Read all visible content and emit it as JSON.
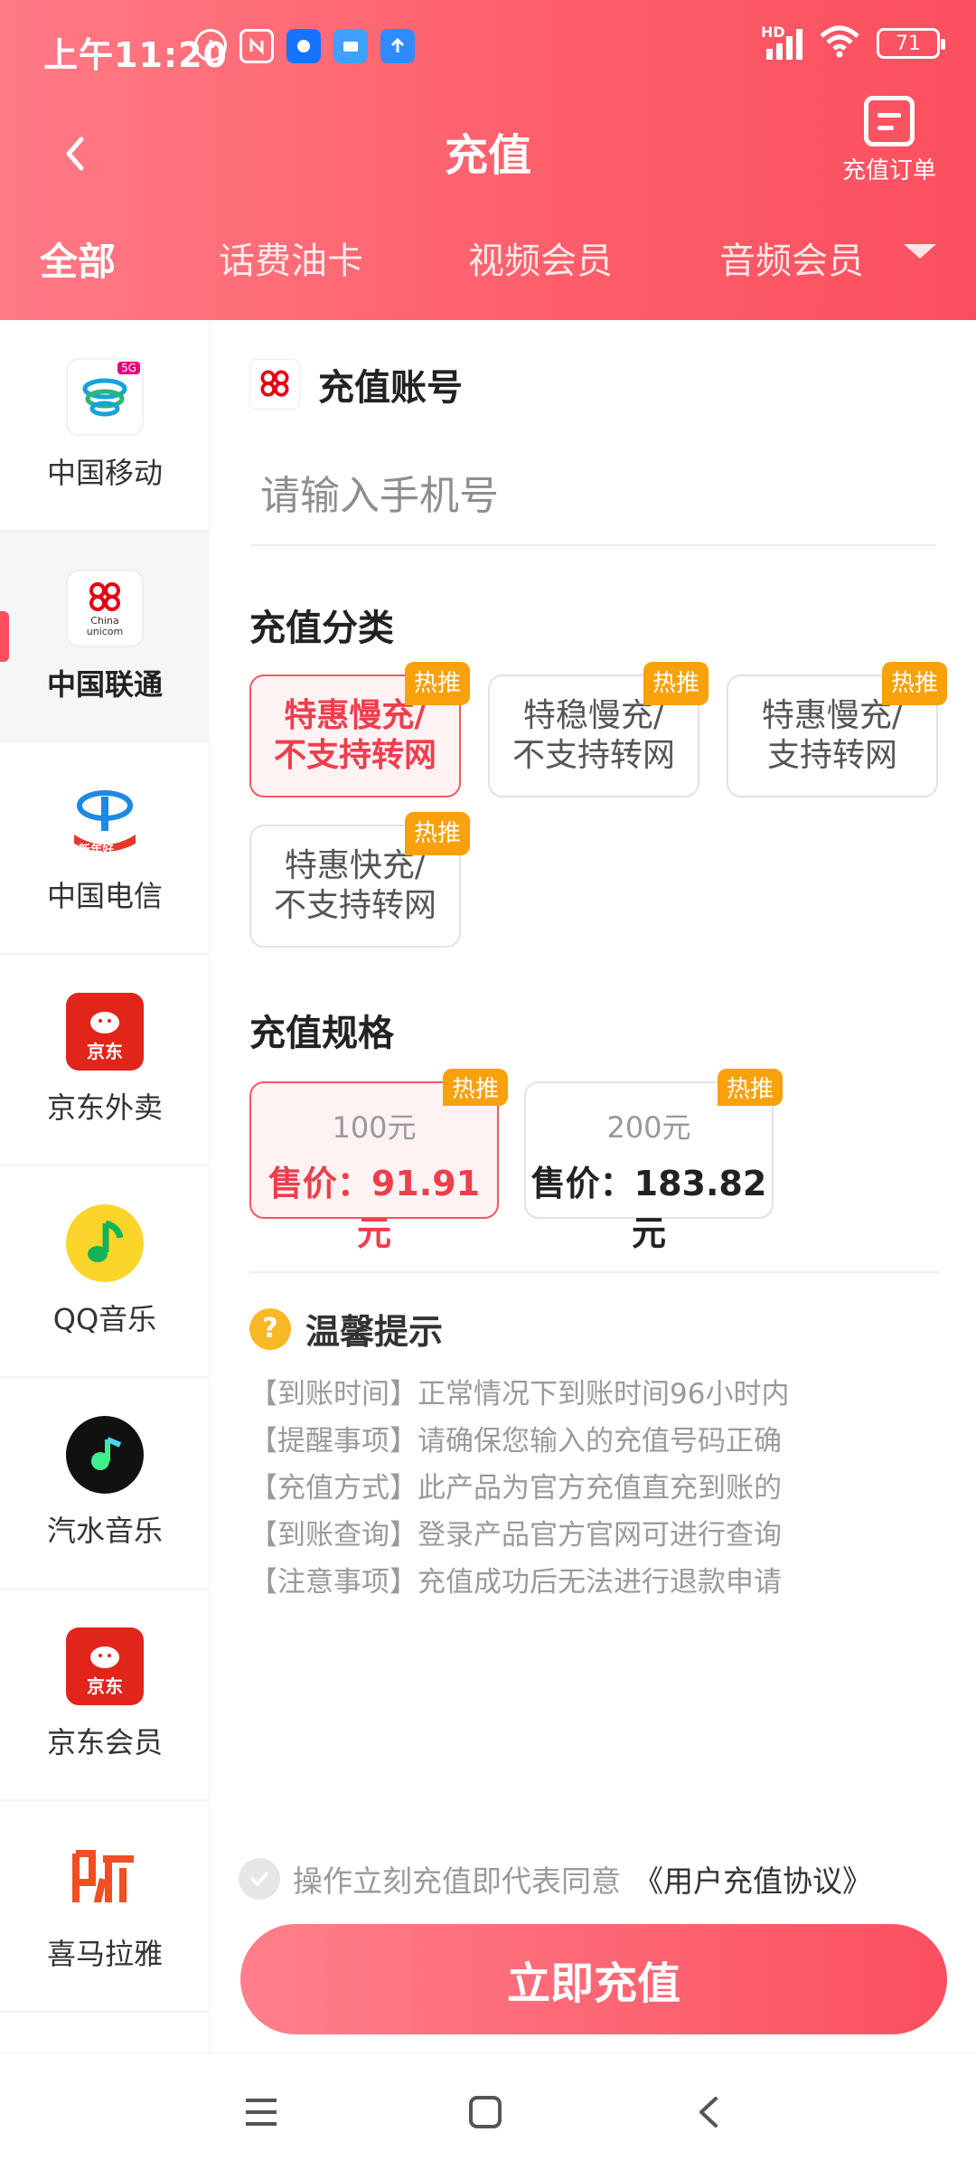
{
  "status_bar": {
    "time": "上午11:20",
    "hd_label": "HD",
    "battery": "71"
  },
  "header": {
    "title": "充值",
    "order_label": "充值订单"
  },
  "tabs": [
    {
      "label": "全部",
      "active": true
    },
    {
      "label": "话费油卡",
      "active": false
    },
    {
      "label": "视频会员",
      "active": false
    },
    {
      "label": "音频会员",
      "active": false
    }
  ],
  "sidebar": {
    "items": [
      {
        "label": "中国移动",
        "icon": "china-mobile-icon"
      },
      {
        "label": "中国联通",
        "icon": "china-unicom-icon",
        "active": true
      },
      {
        "label": "中国电信",
        "icon": "china-telecom-icon"
      },
      {
        "label": "京东外卖",
        "icon": "jd-icon"
      },
      {
        "label": "QQ音乐",
        "icon": "qq-music-icon"
      },
      {
        "label": "汽水音乐",
        "icon": "qishui-music-icon"
      },
      {
        "label": "京东会员",
        "icon": "jd-icon"
      },
      {
        "label": "喜马拉雅",
        "icon": "ximalaya-icon"
      }
    ],
    "unicom_logo_text": "China unicom",
    "mobile_badge": "5G",
    "telecom_badge": "新年好",
    "jd_logo_text": "京东"
  },
  "account": {
    "title": "充值账号",
    "placeholder": "请输入手机号",
    "logo_text": "China unicom"
  },
  "category": {
    "title": "充值分类",
    "items": [
      {
        "line1": "特惠慢充/",
        "line2": "不支持转网",
        "badge": "热推",
        "selected": true
      },
      {
        "line1": "特稳慢充/",
        "line2": "不支持转网",
        "badge": "热推",
        "selected": false
      },
      {
        "line1": "特惠慢充/",
        "line2": "支持转网",
        "badge": "热推",
        "selected": false
      },
      {
        "line1": "特惠快充/",
        "line2": "不支持转网",
        "badge": "热推",
        "selected": false
      }
    ]
  },
  "spec": {
    "title": "充值规格",
    "items": [
      {
        "face": "100元",
        "price": "售价：91.91元",
        "badge": "热推",
        "selected": true
      },
      {
        "face": "200元",
        "price": "售价：183.82元",
        "badge": "热推",
        "selected": false
      }
    ]
  },
  "tips": {
    "title": "温馨提示",
    "items": [
      "【到账时间】正常情况下到账时间96小时内",
      "【提醒事项】请确保您输入的充值号码正确",
      "【充值方式】此产品为官方充值直充到账的",
      "【到账查询】登录产品官方官网可进行查询",
      "【注意事项】充值成功后无法进行退款申请"
    ]
  },
  "agreement": {
    "text": "操作立刻充值即代表同意",
    "link": "《用户充值协议》"
  },
  "cta": {
    "label": "立即充值"
  },
  "colors": {
    "accent": "#fb4f5f",
    "badge": "#f9a10a",
    "selected_bg": "#fff2f3"
  }
}
